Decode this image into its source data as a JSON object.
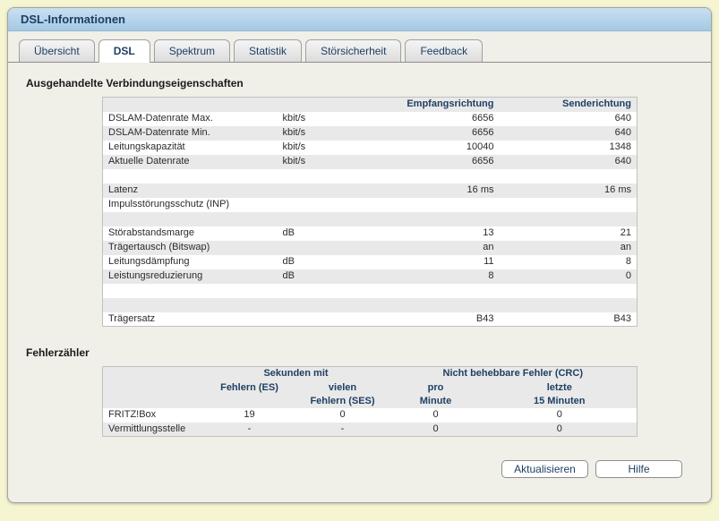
{
  "window": {
    "title": "DSL-Informationen"
  },
  "tabs": [
    {
      "label": "Übersicht",
      "active": false
    },
    {
      "label": "DSL",
      "active": true
    },
    {
      "label": "Spektrum",
      "active": false
    },
    {
      "label": "Statistik",
      "active": false
    },
    {
      "label": "Störsicherheit",
      "active": false
    },
    {
      "label": "Feedback",
      "active": false
    }
  ],
  "connection": {
    "heading": "Ausgehandelte Verbindungseigenschaften",
    "columns": {
      "rx": "Empfangsrichtung",
      "tx": "Senderichtung"
    },
    "rows": [
      {
        "label": "DSLAM-Datenrate Max.",
        "unit": "kbit/s",
        "rx": "6656",
        "tx": "640"
      },
      {
        "label": "DSLAM-Datenrate Min.",
        "unit": "kbit/s",
        "rx": "6656",
        "tx": "640"
      },
      {
        "label": "Leitungskapazität",
        "unit": "kbit/s",
        "rx": "10040",
        "tx": "1348"
      },
      {
        "label": "Aktuelle Datenrate",
        "unit": "kbit/s",
        "rx": "6656",
        "tx": "640"
      },
      {
        "label": "",
        "unit": "",
        "rx": "",
        "tx": ""
      },
      {
        "label": "Latenz",
        "unit": "",
        "rx": "16 ms",
        "tx": "16 ms"
      },
      {
        "label": "Impulsstörungsschutz (INP)",
        "unit": "",
        "rx": "",
        "tx": ""
      },
      {
        "label": "",
        "unit": "",
        "rx": "",
        "tx": ""
      },
      {
        "label": "Störabstandsmarge",
        "unit": "dB",
        "rx": "13",
        "tx": "21"
      },
      {
        "label": "Trägertausch (Bitswap)",
        "unit": "",
        "rx": "an",
        "tx": "an"
      },
      {
        "label": "Leitungsdämpfung",
        "unit": "dB",
        "rx": "11",
        "tx": "8"
      },
      {
        "label": "Leistungsreduzierung",
        "unit": "dB",
        "rx": "8",
        "tx": "0"
      },
      {
        "label": "",
        "unit": "",
        "rx": "",
        "tx": ""
      },
      {
        "label": "",
        "unit": "",
        "rx": "",
        "tx": ""
      },
      {
        "label": "Trägersatz",
        "unit": "",
        "rx": "B43",
        "tx": "B43"
      }
    ]
  },
  "errors": {
    "heading": "Fehlerzähler",
    "group_seconds": "Sekunden mit",
    "group_crc": "Nicht behebbare Fehler (CRC)",
    "col_es": "Fehlern (ES)",
    "col_ses_line1": "vielen",
    "col_ses_line2": "Fehlern (SES)",
    "col_min_line1": "pro",
    "col_min_line2": "Minute",
    "col_15_line1": "letzte",
    "col_15_line2": "15 Minuten",
    "rows": [
      {
        "label": "FRITZ!Box",
        "es": "19",
        "ses": "0",
        "min": "0",
        "m15": "0"
      },
      {
        "label": "Vermittlungsstelle",
        "es": "-",
        "ses": "-",
        "min": "0",
        "m15": "0"
      }
    ]
  },
  "buttons": {
    "refresh": "Aktualisieren",
    "help": "Hilfe"
  },
  "colors": {
    "page_background": "#F5F5D2",
    "panel_background": "#F0EFE8",
    "titlebar_top": "#C9DFF0",
    "titlebar_bottom": "#A4C9E4",
    "accent_text": "#1E3F63",
    "row_stripe": "#E9E9E9"
  }
}
